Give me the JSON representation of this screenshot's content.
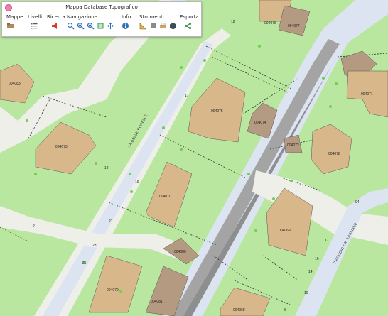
{
  "toolbar": {
    "title": "Mappa Database Topografico",
    "groups": [
      {
        "label": "Mappe"
      },
      {
        "label": "Livelli"
      },
      {
        "label": "Ricerca"
      },
      {
        "label": "Navigazione"
      },
      {
        "label": "Info"
      },
      {
        "label": "Strumenti"
      },
      {
        "label": "Esporta"
      }
    ]
  },
  "map": {
    "colors": {
      "lawn": "#b9e7a0",
      "pavement": "#efefea",
      "road": "#dbe4f0",
      "building": "#d8b88a",
      "building_dark": "#b49a80",
      "rail": "#a4a4a4"
    },
    "streets": {
      "via_delle_ropelle": "VIA DELLE ROPELLE",
      "presidio": "PRESIDIO DR. TARLIANE"
    },
    "buildings": {
      "b1": "004076",
      "b2": "004077",
      "b3": "004071",
      "b4": "004075",
      "b5": "004074",
      "b6": "004073",
      "b7": "004072",
      "b8": "004070",
      "b9": "004069",
      "b10": "004079",
      "b11": "004080",
      "b12": "004081",
      "b13": "004078",
      "b14": "004068",
      "b15": "004083"
    },
    "addresses": {
      "a12top": "12",
      "a17": "17",
      "a12": "12",
      "a19": "19",
      "a21": "21",
      "a23": "23",
      "a25": "25",
      "a2": "2",
      "a17r": "17",
      "a16": "16",
      "a14": "14",
      "a10": "10",
      "a6": "6",
      "a94": "94"
    }
  }
}
